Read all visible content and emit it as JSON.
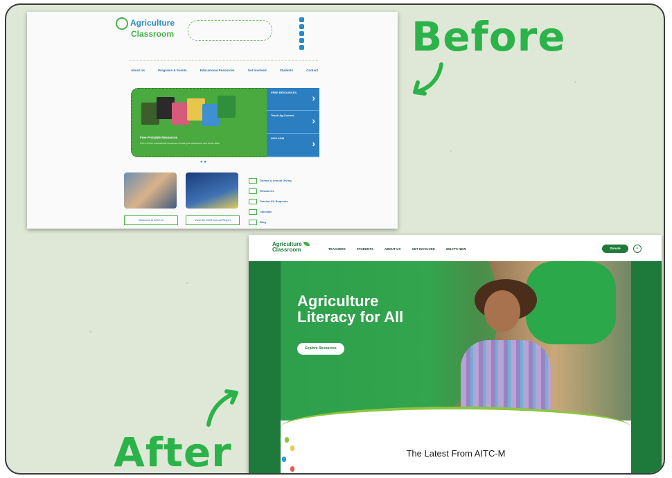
{
  "labels": {
    "before": "Before",
    "after": "After"
  },
  "before_site": {
    "logo_line1": "Agriculture",
    "logo_line2": "Classroom",
    "nav": [
      "About Us",
      "Programs & Events",
      "Educational Resources",
      "Get Involved",
      "Students",
      "Contact"
    ],
    "hero_title": "Free Printable Resources",
    "hero_sub": "Get a of free educational resources to add your classroom and home sites.",
    "side_items": [
      "FREE RESOURCES",
      "Teach Ag Contest",
      "2023 AGM"
    ],
    "list_items": [
      "Donate & Annual Giving",
      "Resources",
      "Teacher Kit Requests",
      "Calendar",
      "Blog"
    ],
    "buttons": [
      "Welcome to AITC-M",
      "View the 2023 Annual Report"
    ]
  },
  "after_site": {
    "logo_line1": "Agriculture",
    "logo_line2": "Classroom",
    "nav": [
      "TEACHERS",
      "STUDENTS",
      "ABOUT US",
      "GET INVOLVED",
      "WHAT'S NEW"
    ],
    "donate": "Donate",
    "headline_1": "Agriculture",
    "headline_2": "Literacy for All",
    "explore": "Explore Resources",
    "latest": "The Latest From AITC-M"
  },
  "colors": {
    "accent_green": "#2bb34a",
    "dark_green": "#1d7a3a",
    "blue": "#2a8bc6"
  }
}
